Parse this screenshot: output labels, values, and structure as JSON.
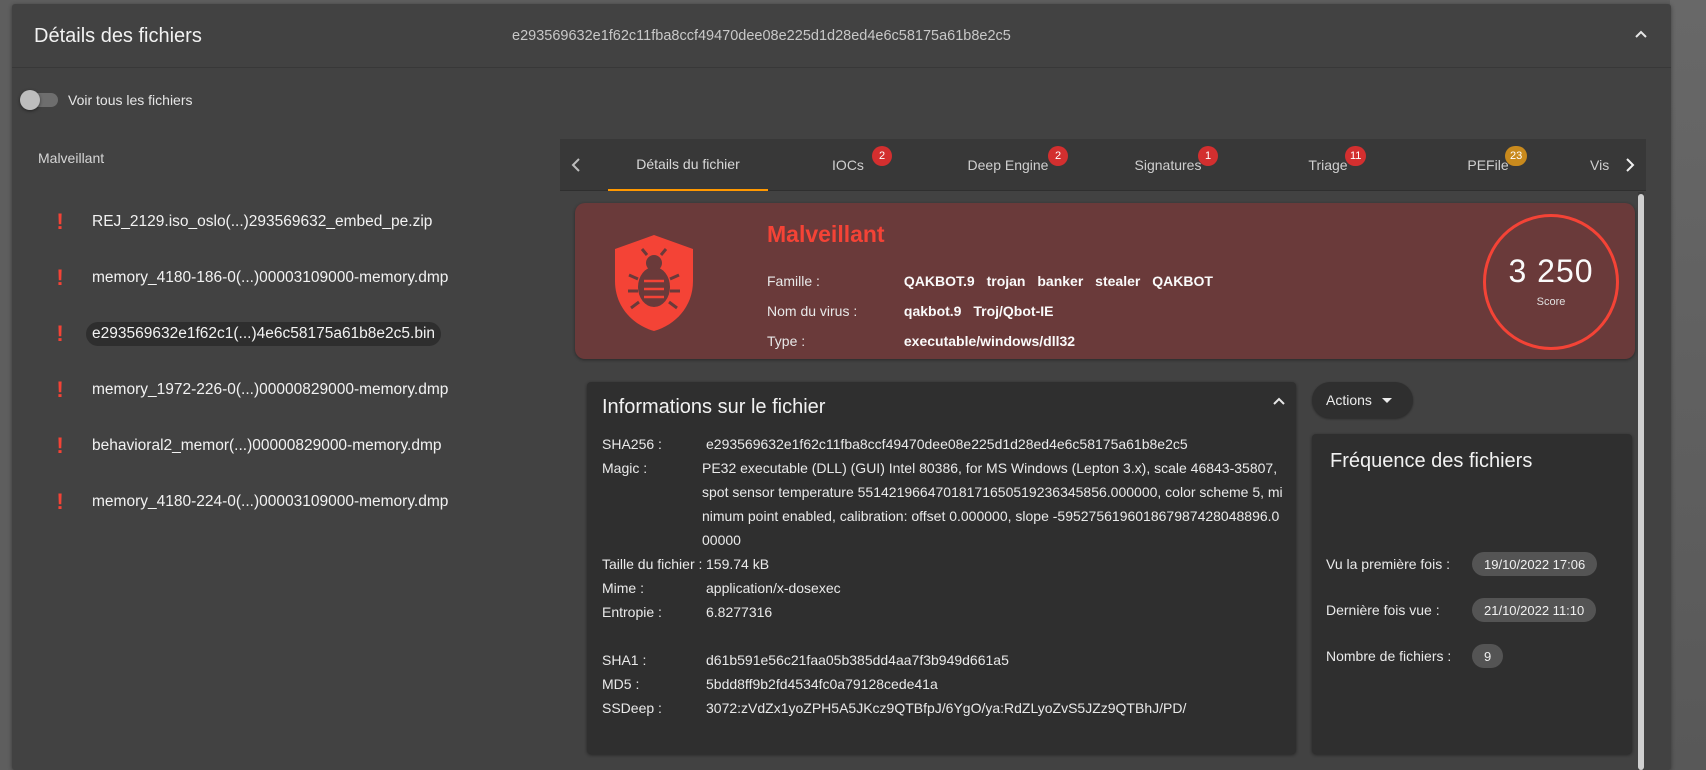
{
  "header": {
    "title": "Détails des fichiers",
    "hash": "e293569632e1f62c11fba8ccf49470dee08e225d1d28ed4e6c58175a61b8e2c5"
  },
  "toggle": {
    "label": "Voir tous les fichiers",
    "checked": false
  },
  "file_list": {
    "group_title": "Malveillant",
    "items": [
      {
        "name": "REJ_2129.iso_oslo(...)293569632_embed_pe.zip",
        "selected": false
      },
      {
        "name": "memory_4180-186-0(...)00003109000-memory.dmp",
        "selected": false
      },
      {
        "name": "e293569632e1f62c1(...)4e6c58175a61b8e2c5.bin",
        "selected": true
      },
      {
        "name": "memory_1972-226-0(...)00000829000-memory.dmp",
        "selected": false
      },
      {
        "name": "behavioral2_memor(...)00000829000-memory.dmp",
        "selected": false
      },
      {
        "name": "memory_4180-224-0(...)00003109000-memory.dmp",
        "selected": false
      }
    ]
  },
  "tabs": [
    {
      "label": "Détails du fichier",
      "badge": "",
      "active": true
    },
    {
      "label": "IOCs",
      "badge": "2",
      "badge_color": "red"
    },
    {
      "label": "Deep Engine",
      "badge": "2",
      "badge_color": "red"
    },
    {
      "label": "Signatures",
      "badge": "1",
      "badge_color": "red"
    },
    {
      "label": "Triage",
      "badge": "11",
      "badge_color": "red"
    },
    {
      "label": "PEFile",
      "badge": "23",
      "badge_color": "orange"
    },
    {
      "label": "Vis",
      "badge": ""
    }
  ],
  "verdict": {
    "title": "Malveillant",
    "famille_label": "Famille :",
    "famille": [
      "QAKBOT.9",
      "trojan",
      "banker",
      "stealer",
      "QAKBOT"
    ],
    "virus_label": "Nom du virus :",
    "virus": [
      "qakbot.9",
      "Troj/Qbot-IE"
    ],
    "type_label": "Type :",
    "type": "executable/windows/dll32",
    "score": "3 250",
    "score_label": "Score",
    "color": "#f44336"
  },
  "file_info": {
    "title": "Informations sur le fichier",
    "sha256_label": "SHA256 :",
    "sha256": "e293569632e1f62c11fba8ccf49470dee08e225d1d28ed4e6c58175a61b8e2c5",
    "magic_label": "Magic :",
    "magic": " PE32 executable (DLL) (GUI) Intel 80386, for MS Windows (Lepton 3.x), scale 46843-35807, spot sensor temperature 5514219664701817165051923634585​6.000000, color scheme 5, minimum point enabled, calibration: offset 0.000000, slope -5952756196018679874280488​96.000000",
    "size_label": "Taille du fichier :",
    "size": "159.74 kB",
    "mime_label": "Mime :",
    "mime": "application/x-dosexec",
    "entropy_label": "Entropie :",
    "entropy": "6.8277316",
    "sha1_label": "SHA1 :",
    "sha1": "d61b591e56c21faa05b385dd4aa7f3b949d661a5",
    "md5_label": "MD5 :",
    "md5": "5bdd8ff9b2fd4534fc0a79128cede41a",
    "ssdeep_label": "SSDeep :",
    "ssdeep": "3072:zVdZx1yoZPH5A5JKcz9QTBfpJ/6YgO/ya:RdZLyoZvS5JZz9QTBhJ/PD/"
  },
  "actions": {
    "label": "Actions"
  },
  "frequency": {
    "title": "Fréquence des fichiers",
    "first_seen_label": "Vu la première fois :",
    "first_seen": "19/10/2022 17:06",
    "last_seen_label": "Dernière fois vue :",
    "last_seen": "21/10/2022 11:10",
    "count_label": "Nombre de fichiers :",
    "count": "9"
  }
}
